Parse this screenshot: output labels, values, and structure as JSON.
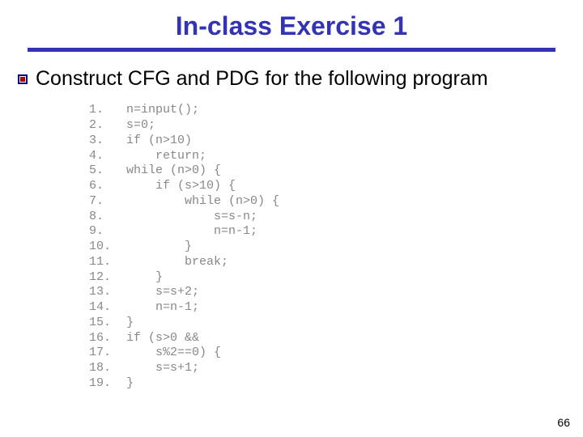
{
  "title": "In-class Exercise 1",
  "prompt": "Construct CFG and PDG for the following program",
  "page_number": "66",
  "code": [
    {
      "n": "1.",
      "t": "n=input();"
    },
    {
      "n": "2.",
      "t": "s=0;"
    },
    {
      "n": "3.",
      "t": "if (n>10)"
    },
    {
      "n": "4.",
      "t": "    return;"
    },
    {
      "n": "5.",
      "t": "while (n>0) {"
    },
    {
      "n": "6.",
      "t": "    if (s>10) {"
    },
    {
      "n": "7.",
      "t": "        while (n>0) {"
    },
    {
      "n": "8.",
      "t": "            s=s-n;"
    },
    {
      "n": "9.",
      "t": "            n=n-1;"
    },
    {
      "n": "10.",
      "t": "        }"
    },
    {
      "n": "11.",
      "t": "        break;"
    },
    {
      "n": "12.",
      "t": "    }"
    },
    {
      "n": "13.",
      "t": "    s=s+2;"
    },
    {
      "n": "14.",
      "t": "    n=n-1;"
    },
    {
      "n": "15.",
      "t": "}"
    },
    {
      "n": "16.",
      "t": "if (s>0 &&"
    },
    {
      "n": "17.",
      "t": "    s%2==0) {"
    },
    {
      "n": "18.",
      "t": "    s=s+1;"
    },
    {
      "n": "19.",
      "t": "}"
    }
  ]
}
